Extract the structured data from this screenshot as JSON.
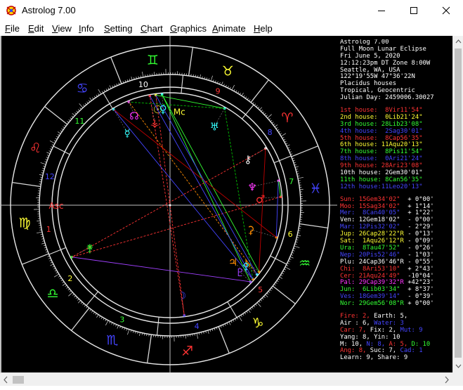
{
  "window": {
    "title": "Astrolog 7.00",
    "controls": {
      "minimize": "—",
      "maximize": "☐",
      "close": "✕"
    }
  },
  "menu": [
    {
      "key": "file",
      "label": "File",
      "mnemonic": "F",
      "rest": "ile"
    },
    {
      "key": "edit",
      "label": "Edit",
      "mnemonic": "E",
      "rest": "dit"
    },
    {
      "key": "view",
      "label": "View",
      "mnemonic": "V",
      "rest": "iew"
    },
    {
      "key": "info",
      "label": "Info",
      "mnemonic": "I",
      "rest": "nfo"
    },
    {
      "key": "setting",
      "label": "Setting",
      "mnemonic": "S",
      "rest": "etting"
    },
    {
      "key": "chart",
      "label": "Chart",
      "mnemonic": "C",
      "rest": "hart"
    },
    {
      "key": "graphics",
      "label": "Graphics",
      "mnemonic": "G",
      "rest": "raphics"
    },
    {
      "key": "animate",
      "label": "Animate",
      "mnemonic": "A",
      "rest": "nimate"
    },
    {
      "key": "help",
      "label": "Help",
      "mnemonic": "H",
      "rest": "elp"
    }
  ],
  "colors": {
    "white": "#ffffff",
    "red": "#ff3333",
    "darkred": "#c00000",
    "green": "#33ff33",
    "darkgreen": "#00c000",
    "yellow": "#ffff33",
    "orange": "#ff8c00",
    "blue": "#4444ff",
    "cyan": "#33ffff",
    "magenta": "#ff33ff",
    "purple": "#a040ff",
    "gray": "#9a9a9a",
    "ltgray": "#cfcfcf"
  },
  "info_header": [
    "Astrolog 7.00",
    "Full Moon Lunar Eclipse",
    "Fri June 5, 2020",
    "12:12:23pm DT Zone 8:00W",
    "Seattle, WA, USA",
    "122°19'55W 47°36'22N",
    "Placidus houses",
    "Tropical, Geocentric",
    "Julian Day: 2459006.30027"
  ],
  "houses": [
    {
      "label": "1st house:",
      "value": " 8Vir11'54\"",
      "color": "red"
    },
    {
      "label": "2nd house:",
      "value": " 0Lib21'24\"",
      "color": "yellow"
    },
    {
      "label": "3rd house:",
      "value": "28Lib23'08\"",
      "color": "green"
    },
    {
      "label": "4th house:",
      "value": " 2Sag30'01\"",
      "color": "blue"
    },
    {
      "label": "5th house:",
      "value": " 8Cap56'35\"",
      "color": "red"
    },
    {
      "label": "6th house:",
      "value": "11Aqu20'13\"",
      "color": "yellow"
    },
    {
      "label": "7th house:",
      "value": " 8Pis11'54\"",
      "color": "green"
    },
    {
      "label": "8th house:",
      "value": " 0Ari21'24\"",
      "color": "blue"
    },
    {
      "label": "9th house:",
      "value": "28Ari23'08\"",
      "color": "red"
    },
    {
      "label": "10th house:",
      "value": " 2Gem30'01\"",
      "color": "white"
    },
    {
      "label": "11th house:",
      "value": " 8Can56'35\"",
      "color": "green"
    },
    {
      "label": "12th house:",
      "value": "11Leo20'13\"",
      "color": "blue"
    }
  ],
  "planets": [
    {
      "name": "Sun:",
      "pos": "15Gem34'02\"",
      "lat": "+ 0°00'",
      "color": "red"
    },
    {
      "name": "Moo:",
      "pos": "15Sag34'02\"",
      "lat": "+ 1°14'",
      "color": "red"
    },
    {
      "name": "Mer:",
      "pos": " 8Can40'05\"",
      "lat": "+ 1°22'",
      "color": "blue"
    },
    {
      "name": "Ven:",
      "pos": "12Gem18'02\"",
      "lat": "- 0°00'",
      "color": "white"
    },
    {
      "name": "Mar:",
      "pos": "12Pis32'02\"",
      "lat": "- 2°29'",
      "color": "blue"
    },
    {
      "name": "Jup:",
      "pos": "26Cap28'22\"R",
      "lat": "- 0°13'",
      "color": "yellow"
    },
    {
      "name": "Sat:",
      "pos": " 1Aqu26'12\"R",
      "lat": "- 0°09'",
      "color": "yellow"
    },
    {
      "name": "Ura:",
      "pos": " 8Tau47'52\"",
      "lat": "- 0°26'",
      "color": "green"
    },
    {
      "name": "Nep:",
      "pos": "20Pis52'46\"",
      "lat": "- 1°03'",
      "color": "blue"
    },
    {
      "name": "Plu:",
      "pos": "24Cap36'46\"R",
      "lat": "- 0°55'",
      "color": "white"
    },
    {
      "name": "Chi:",
      "pos": " 8Ari53'10\"",
      "lat": "+ 2°43'",
      "color": "red"
    },
    {
      "name": "Cer:",
      "pos": "21Aqu24'49\"",
      "lat": "-10°04'",
      "color": "red"
    },
    {
      "name": "Pal:",
      "pos": "29Cap39'32\"R",
      "lat": "+42°23'",
      "color": "magenta"
    },
    {
      "name": "Jun:",
      "pos": " 6Lib03'34\"",
      "lat": "+ 8°37'",
      "color": "green"
    },
    {
      "name": "Ves:",
      "pos": "18Gem39'14\"",
      "lat": "- 0°39'",
      "color": "blue"
    },
    {
      "name": "Nor:",
      "pos": "29Gem56'08\"R",
      "lat": "+ 0°00'",
      "color": "green"
    }
  ],
  "elements": [
    [
      {
        "t": "Fire: 2,",
        "c": "red"
      },
      {
        "t": " Earth: 5,",
        "c": "white"
      }
    ],
    [
      {
        "t": "Air : 6,",
        "c": "white"
      },
      {
        "t": " Water: 3",
        "c": "blue"
      }
    ],
    [
      {
        "t": "Car: 7,",
        "c": "red"
      },
      {
        "t": " Fix: 2,",
        "c": "white"
      },
      {
        "t": " Mut: 9",
        "c": "blue"
      }
    ],
    [
      {
        "t": "Yang: 8,",
        "c": "white"
      },
      {
        "t": " Yin: 10",
        "c": "white"
      }
    ],
    [
      {
        "t": "M: 10,",
        "c": "white"
      },
      {
        "t": " N: 8,",
        "c": "blue"
      },
      {
        "t": " A: 5,",
        "c": "red"
      },
      {
        "t": " D: 10",
        "c": "green"
      }
    ],
    [
      {
        "t": "Ang: 8,",
        "c": "red"
      },
      {
        "t": " Suc: 7,",
        "c": "white"
      },
      {
        "t": " Cad: 1",
        "c": "blue"
      }
    ],
    [
      {
        "t": "Learn: 9,",
        "c": "white"
      },
      {
        "t": " Share: 9",
        "c": "white"
      }
    ]
  ],
  "wheel": {
    "zodiac_signs": [
      {
        "glyph": "♈",
        "name": "aries",
        "color": "red"
      },
      {
        "glyph": "♉",
        "name": "taurus",
        "color": "yellow"
      },
      {
        "glyph": "♊",
        "name": "gemini",
        "color": "green"
      },
      {
        "glyph": "♋",
        "name": "cancer",
        "color": "blue"
      },
      {
        "glyph": "♌",
        "name": "leo",
        "color": "red"
      },
      {
        "glyph": "♍",
        "name": "virgo",
        "color": "yellow"
      },
      {
        "glyph": "♎",
        "name": "libra",
        "color": "green"
      },
      {
        "glyph": "♏",
        "name": "scorpio",
        "color": "blue"
      },
      {
        "glyph": "♐",
        "name": "sagittarius",
        "color": "red"
      },
      {
        "glyph": "♑",
        "name": "capricorn",
        "color": "yellow"
      },
      {
        "glyph": "♒",
        "name": "aquarius",
        "color": "green"
      },
      {
        "glyph": "♓",
        "name": "pisces",
        "color": "blue"
      }
    ],
    "house_numbers": [
      "1",
      "2",
      "3",
      "4",
      "5",
      "6",
      "7",
      "8",
      "9",
      "10",
      "11",
      "12"
    ],
    "angle_labels": {
      "asc": "Asc",
      "mc": "Mc"
    },
    "planet_glyphs": [
      {
        "glyph": "☉",
        "name": "sun",
        "color": "yellow"
      },
      {
        "glyph": "☽",
        "name": "moon",
        "color": "blue"
      },
      {
        "glyph": "☿",
        "name": "mercury",
        "color": "cyan"
      },
      {
        "glyph": "♀",
        "name": "venus",
        "color": "cyan"
      },
      {
        "glyph": "♂",
        "name": "mars",
        "color": "red"
      },
      {
        "glyph": "♃",
        "name": "jupiter",
        "color": "orange"
      },
      {
        "glyph": "♄",
        "name": "saturn",
        "color": "orange"
      },
      {
        "glyph": "♅",
        "name": "uranus",
        "color": "cyan"
      },
      {
        "glyph": "♆",
        "name": "neptune",
        "color": "magenta"
      },
      {
        "glyph": "♇",
        "name": "pluto",
        "color": "purple"
      },
      {
        "glyph": "⚷",
        "name": "chiron",
        "color": "white"
      },
      {
        "glyph": "⚳",
        "name": "ceres",
        "color": "orange"
      },
      {
        "glyph": "⚴",
        "name": "pallas",
        "color": "cyan"
      },
      {
        "glyph": "⚵",
        "name": "juno",
        "color": "green"
      },
      {
        "glyph": "⚶",
        "name": "vesta",
        "color": "red"
      },
      {
        "glyph": "☊",
        "name": "north-node",
        "color": "magenta"
      }
    ]
  }
}
